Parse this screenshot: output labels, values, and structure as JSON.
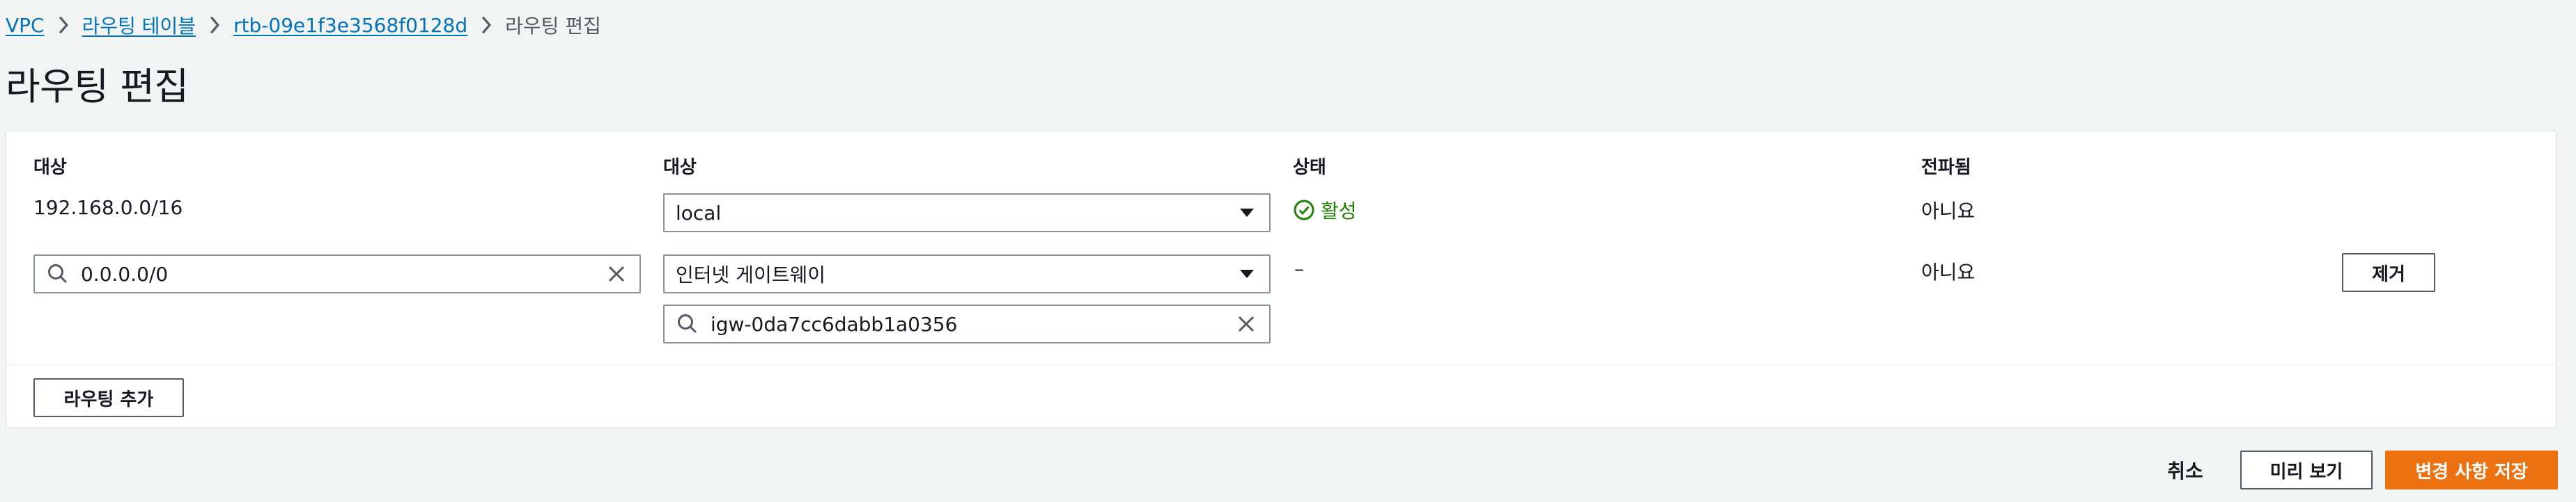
{
  "breadcrumb": {
    "items": [
      "VPC",
      "라우팅 테이블",
      "rtb-09e1f3e3568f0128d"
    ],
    "current": "라우팅 편집"
  },
  "page_title": "라우팅 편집",
  "table": {
    "headers": {
      "destination": "대상",
      "target": "대상",
      "status": "상태",
      "propagated": "전파됨"
    },
    "rows": [
      {
        "destination": "192.168.0.0/16",
        "target_select": "local",
        "status": "활성",
        "propagated": "아니요"
      },
      {
        "destination_input": "0.0.0.0/0",
        "target_select": "인터넷 게이트웨이",
        "target_search": "igw-0da7cc6dabb1a0356",
        "status": "–",
        "propagated": "아니요",
        "remove_label": "제거"
      }
    ]
  },
  "add_route_label": "라우팅 추가",
  "footer": {
    "cancel_label": "취소",
    "preview_label": "미리 보기",
    "save_label": "변경 사항 저장"
  },
  "colors": {
    "link": "#0073bb",
    "success": "#1d8102",
    "primary": "#ec7211",
    "background": "#f2f3f3"
  },
  "icons": [
    "chevron-right-icon",
    "search-icon",
    "clear-icon",
    "caret-down-icon",
    "check-circle-icon"
  ]
}
